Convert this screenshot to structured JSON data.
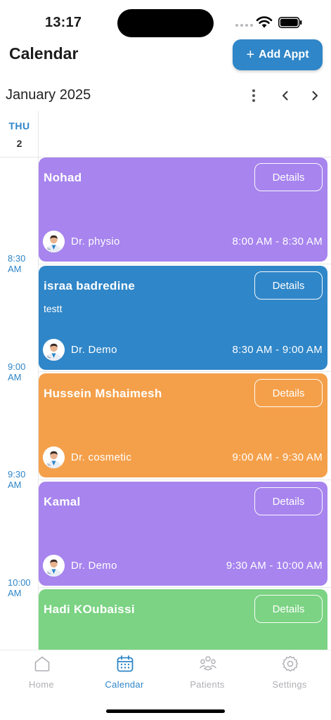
{
  "status_bar": {
    "time": "13:17"
  },
  "header": {
    "title": "Calendar",
    "add_button_label": "Add Appt",
    "add_button_icon": "plus-icon"
  },
  "calendar": {
    "month_label": "January 2025",
    "day_name": "THU",
    "day_number": "2",
    "time_labels": [
      {
        "hour": "8:30",
        "period": "AM"
      },
      {
        "hour": "9:00",
        "period": "AM"
      },
      {
        "hour": "9:30",
        "period": "AM"
      },
      {
        "hour": "10:00",
        "period": "AM"
      }
    ]
  },
  "appointments": [
    {
      "patient": "Nohad",
      "note": "",
      "doctor": "Dr. physio",
      "time": "8:00 AM - 8:30 AM",
      "color": "#a784ee",
      "details_label": "Details"
    },
    {
      "patient": "israa badredine",
      "note": "testt",
      "doctor": "Dr. Demo",
      "time": "8:30 AM - 9:00 AM",
      "color": "#2f86c8",
      "details_label": "Details"
    },
    {
      "patient": "Hussein Mshaimesh",
      "note": "",
      "doctor": "Dr. cosmetic",
      "time": "9:00 AM - 9:30 AM",
      "color": "#f4a04a",
      "details_label": "Details"
    },
    {
      "patient": "Kamal",
      "note": "",
      "doctor": "Dr. Demo",
      "time": "9:30 AM - 10:00 AM",
      "color": "#a784ee",
      "details_label": "Details"
    },
    {
      "patient": "Hadi KOubaissi",
      "note": "",
      "doctor": "",
      "time": "",
      "color": "#7bd383",
      "details_label": "Details"
    }
  ],
  "tab_bar": {
    "tabs": [
      {
        "label": "Home",
        "icon": "home-icon",
        "active": false
      },
      {
        "label": "Calendar",
        "icon": "calendar-icon",
        "active": true
      },
      {
        "label": "Patients",
        "icon": "patients-icon",
        "active": false
      },
      {
        "label": "Settings",
        "icon": "gear-icon",
        "active": false
      }
    ]
  },
  "colors": {
    "accent": "#2f86c8",
    "inactive_tab": "#b0b0b5"
  }
}
